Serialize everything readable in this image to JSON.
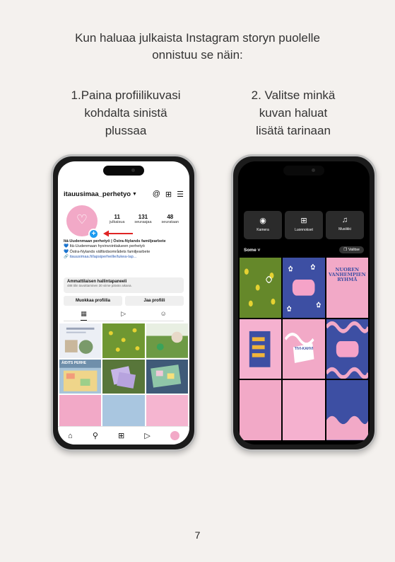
{
  "page": {
    "title_line1": "Kun haluaa julkaista Instagram storyn puolelle",
    "title_line2": "onnistuu se näin:",
    "step1_line1": "1.Paina profiilikuvasi",
    "step1_line2": "kohdalta sinistä",
    "step1_line3": "plussaa",
    "step2_line1": "2. Valitse minkä",
    "step2_line2": "kuvan haluat",
    "step2_line3": "lisätä tarinaan",
    "page_number": "7"
  },
  "profile_screen": {
    "username": "itauusimaa_perhetyo",
    "stats": [
      {
        "value": "11",
        "label": "julkaisua"
      },
      {
        "value": "131",
        "label": "seuraajaa"
      },
      {
        "value": "48",
        "label": "seurataan"
      }
    ],
    "bio_name": "Itä-Uudenmaan perhetyö | Östra-Nylands familjearbete",
    "bio_line1": "💙 Itä-Uudenmaan hyvinvointialueen perhetyö",
    "bio_line2": "💙 Östra-Nylands välfärdsområdets familjearbete",
    "bio_link": "itauusimaa.fi/lapsiperheille/tukea-lap...",
    "pro_panel_title": "Ammattilaisen hallintapaneeli",
    "pro_panel_sub": "488 tilin tavoittaminen 30 viime päivän aikana.",
    "edit_profile_button": "Muokkaa profiilia",
    "share_profile_button": "Jaa profiili",
    "grid_tile_text": "ÄIDITS PERHE"
  },
  "picker_screen": {
    "camera_label": "Kamera",
    "drafts_label": "Luonnokset",
    "music_label": "Musiikki",
    "album_name": "Some",
    "select_button": "Valitse",
    "tile_title": "NUOREN VANHEMPIEN RYHMÄ",
    "tile_sign": "TIVI-KAHVI"
  },
  "colors": {
    "instagram_pink": "#f2a9c7",
    "story_blue": "#3d4fa3",
    "plus_blue": "#1d9bf0",
    "arrow_red": "#e02424"
  }
}
